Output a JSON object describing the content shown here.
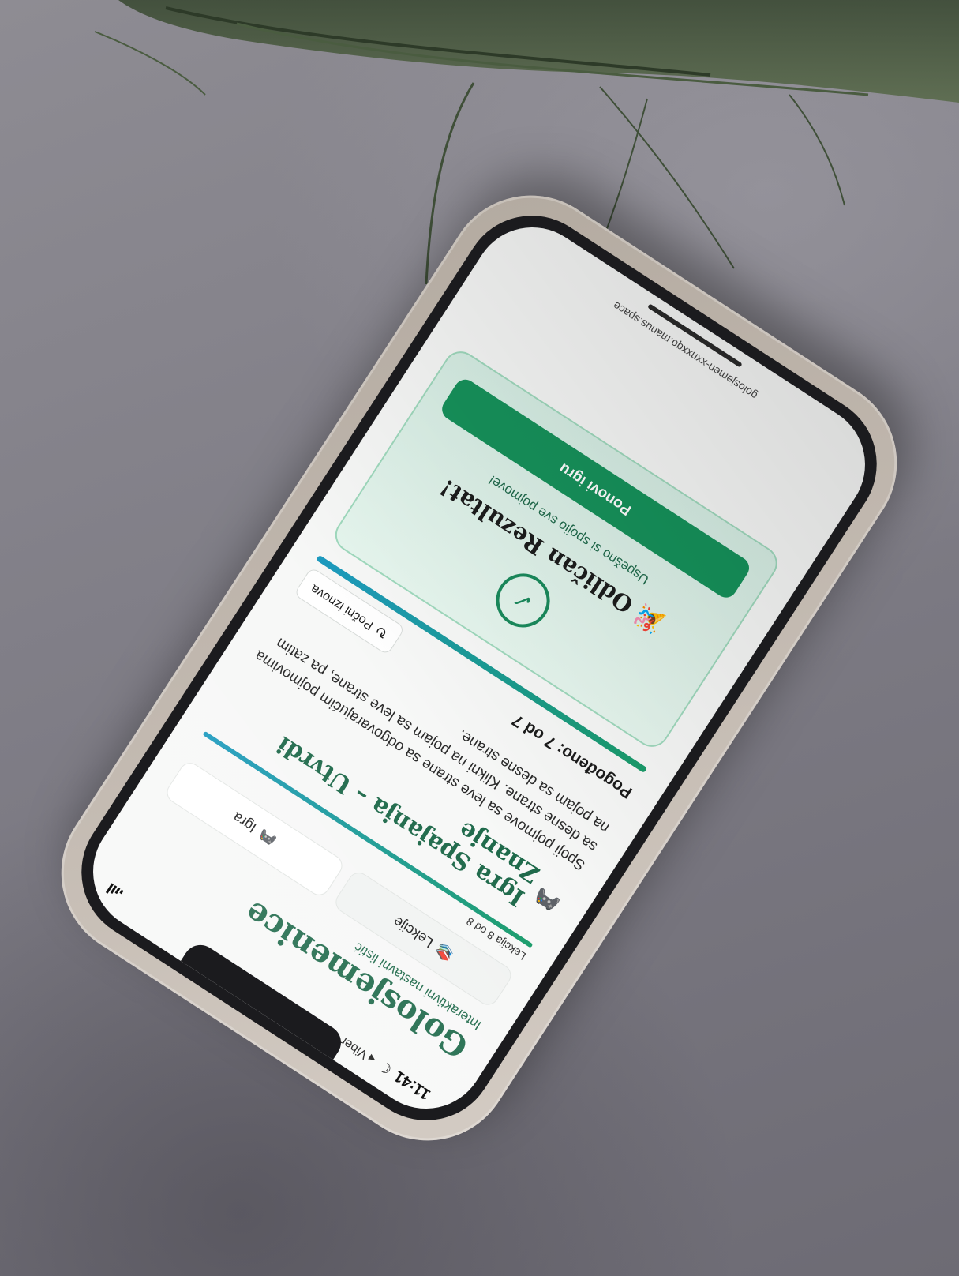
{
  "status_bar": {
    "time": "11:41",
    "back_app": "Viber",
    "moon_glyph": "☾",
    "back_glyph": "◂"
  },
  "header": {
    "title": "Golosjemenice",
    "subtitle": "Interaktivni nastavni listić"
  },
  "nav": {
    "lessons_icon": "📚",
    "lessons_label": "Lekcije",
    "game_icon": "🎮",
    "game_label": "Igra"
  },
  "lesson_progress": {
    "text": "Lekcija 8 od 8",
    "fraction": 1.0
  },
  "game": {
    "icon": "🎮",
    "title": "Igra Spajanja – Utvrdi Znanje",
    "instructions": "Spoji pojmove sa leve strane sa odgovarajućim pojmovima sa desne strane. Klikni na pojam sa leve strane, pa zatim na pojam sa desne strane."
  },
  "score": {
    "label": "Pogođeno: 7 od 7",
    "matched": 7,
    "total": 7,
    "restart_icon": "↻",
    "restart_label": "Počni iznova"
  },
  "result": {
    "check_glyph": "✓",
    "title": "🎉 Odličan Rezultat!",
    "text": "Uspešno si spojio sve pojmove!",
    "button_label": "Ponovi igru"
  },
  "browser": {
    "url": "golosjemen-xxnxxqo.manus.space"
  },
  "colors": {
    "accent_green": "#16925b",
    "title_green": "#1f6a4b",
    "progress_blue": "#1c9ac0",
    "card_bg": "#e6f6ee"
  }
}
